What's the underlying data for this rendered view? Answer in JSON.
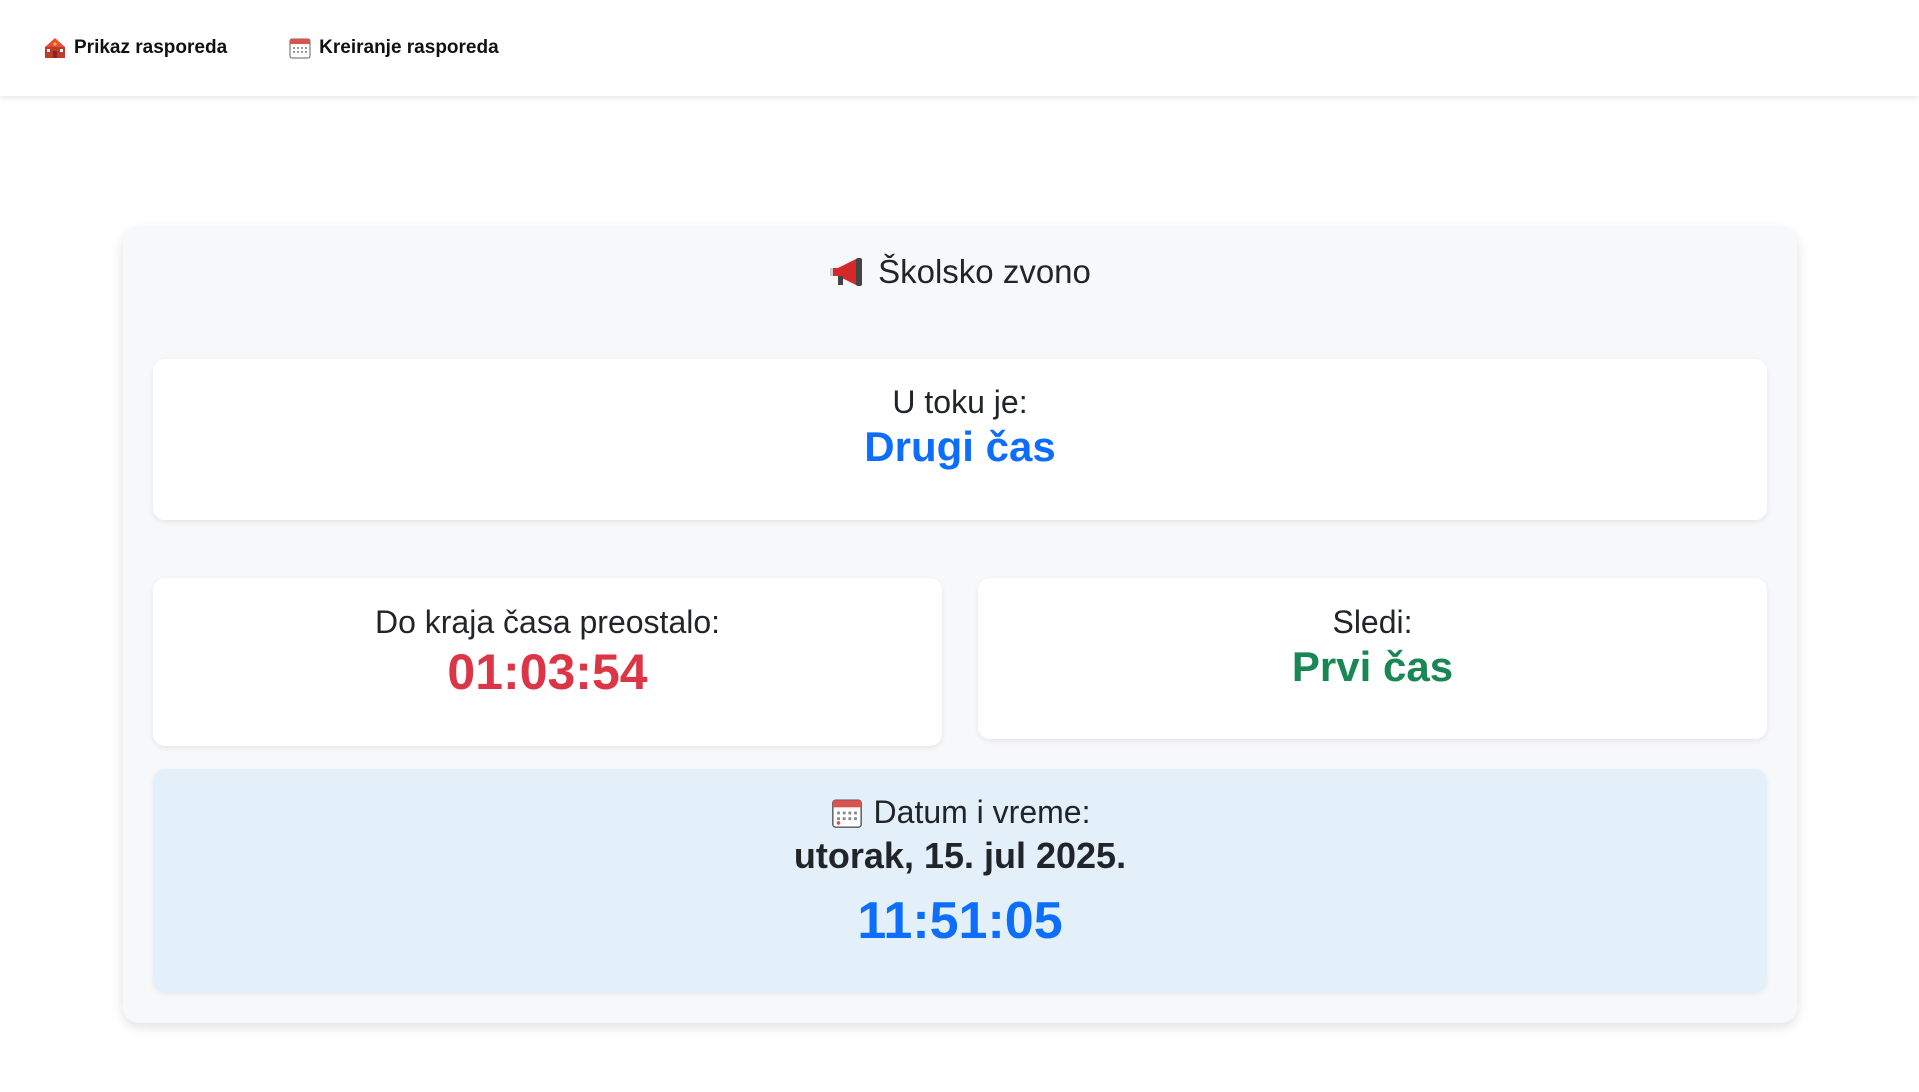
{
  "nav": {
    "items": [
      {
        "label": "Prikaz rasporeda",
        "icon": "school-icon"
      },
      {
        "label": "Kreiranje rasporeda",
        "icon": "calendar-icon"
      }
    ]
  },
  "card": {
    "title": "Školsko zvono",
    "title_icon": "megaphone-icon"
  },
  "current": {
    "label": "U toku je:",
    "value": "Drugi čas",
    "color": "#0d6efd"
  },
  "remaining": {
    "label": "Do kraja časa preostalo:",
    "value": "01:03:54",
    "color": "#dc3545"
  },
  "next": {
    "label": "Sledi:",
    "value": "Prvi čas",
    "color": "#198754"
  },
  "datetime": {
    "label": "Datum i vreme:",
    "icon": "calendar-icon",
    "date": "utorak, 15. jul 2025.",
    "time": "11:51:05",
    "background": "#e3f0fa"
  }
}
